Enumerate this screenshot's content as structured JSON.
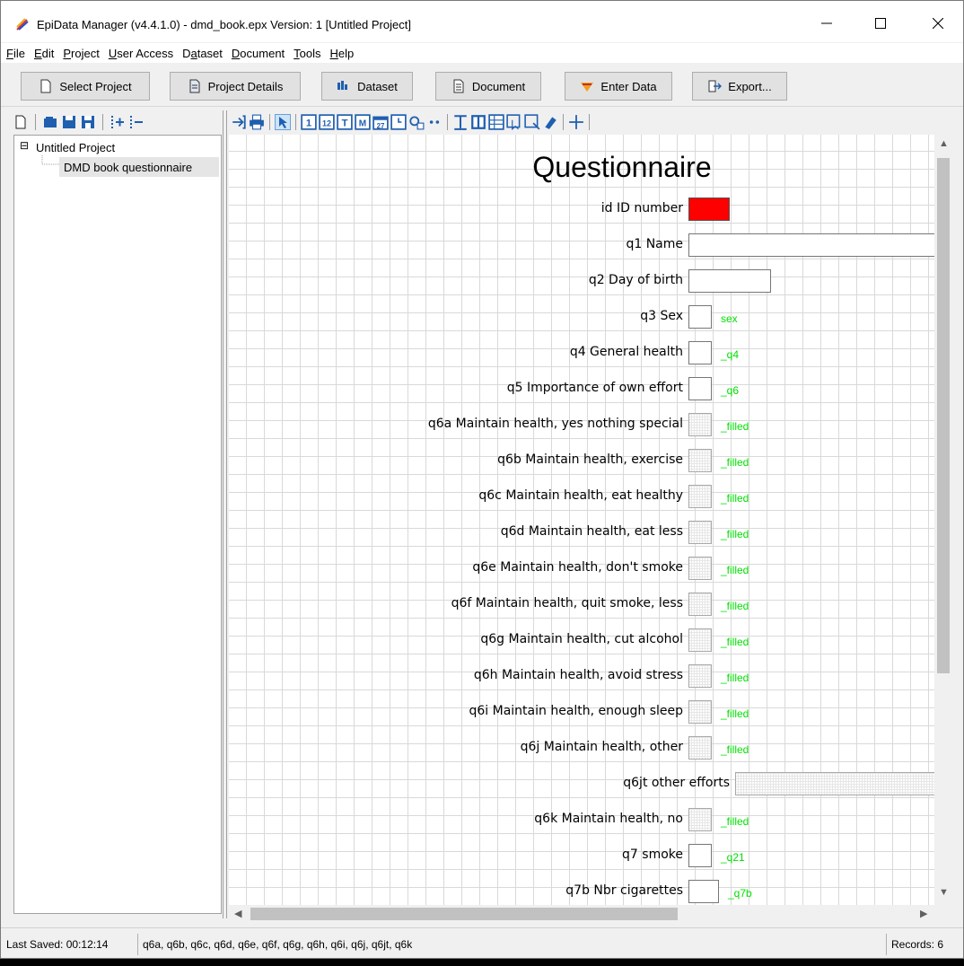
{
  "window": {
    "title": "EpiData Manager (v4.4.1.0) - dmd_book.epx Version: 1 [Untitled Project]",
    "minimize_glyph": "—",
    "maximize_glyph": "☐",
    "close_glyph": "✕"
  },
  "menu": [
    {
      "key": "F",
      "rest": "ile"
    },
    {
      "key": "E",
      "rest": "dit"
    },
    {
      "key": "P",
      "rest": "roject",
      "pre": ""
    },
    {
      "key": "U",
      "rest": "ser Access"
    },
    {
      "key": "a",
      "pre": "D",
      "rest": "taset"
    },
    {
      "key": "D",
      "rest": "ocument"
    },
    {
      "key": "T",
      "rest": "ools"
    },
    {
      "key": "H",
      "rest": "elp"
    }
  ],
  "toolbar": {
    "select_project": "Select Project",
    "project_details": "Project Details",
    "dataset": "Dataset",
    "document": "Document",
    "enter_data": "Enter Data",
    "export": "Export..."
  },
  "tree": {
    "root": "Untitled Project",
    "child": "DMD book questionnaire",
    "expander": "⊟"
  },
  "form": {
    "heading": "Questionnaire",
    "fields": [
      {
        "label": "id ID number",
        "box": "red",
        "width": 46,
        "vlabel": ""
      },
      {
        "label": "q1 Name",
        "box": "plain",
        "width": 290,
        "vlabel": ""
      },
      {
        "label": "q2 Day of birth",
        "box": "plain",
        "width": 92,
        "vlabel": ""
      },
      {
        "label": "q3 Sex",
        "box": "plain",
        "width": 26,
        "vlabel": "sex"
      },
      {
        "label": "q4 General health",
        "box": "plain",
        "width": 26,
        "vlabel": "_q4"
      },
      {
        "label": "q5 Importance of own effort",
        "box": "plain",
        "width": 26,
        "vlabel": "_q6"
      },
      {
        "label": "q6a Maintain health, yes nothing special",
        "box": "dotted",
        "width": 26,
        "vlabel": "_filled"
      },
      {
        "label": "q6b Maintain health, exercise",
        "box": "dotted",
        "width": 26,
        "vlabel": "_filled"
      },
      {
        "label": "q6c Maintain health, eat healthy",
        "box": "dotted",
        "width": 26,
        "vlabel": "_filled"
      },
      {
        "label": "q6d Maintain health, eat less",
        "box": "dotted",
        "width": 26,
        "vlabel": "_filled"
      },
      {
        "label": "q6e Maintain health, don't smoke",
        "box": "dotted",
        "width": 26,
        "vlabel": "_filled"
      },
      {
        "label": "q6f Maintain health, quit smoke, less",
        "box": "dotted",
        "width": 26,
        "vlabel": "_filled"
      },
      {
        "label": "q6g Maintain health, cut alcohol",
        "box": "dotted",
        "width": 26,
        "vlabel": "_filled"
      },
      {
        "label": "q6h Maintain health, avoid stress",
        "box": "dotted",
        "width": 26,
        "vlabel": "_filled"
      },
      {
        "label": "q6i Maintain health, enough sleep",
        "box": "dotted",
        "width": 26,
        "vlabel": "_filled"
      },
      {
        "label": "q6j Maintain health, other",
        "box": "dotted",
        "width": 26,
        "vlabel": "_filled"
      },
      {
        "label": "q6jt other efforts",
        "box": "dotted",
        "width": 240,
        "vlabel": "",
        "indent": 52
      },
      {
        "label": "q6k Maintain health, no",
        "box": "dotted",
        "width": 26,
        "vlabel": "_filled"
      },
      {
        "label": "q7 smoke",
        "box": "plain",
        "width": 26,
        "vlabel": "_q21"
      },
      {
        "label": "q7b Nbr cigarettes",
        "box": "plain",
        "width": 34,
        "vlabel": "_q7b"
      }
    ]
  },
  "status": {
    "last_saved": "Last Saved: 00:12:14",
    "fields": "q6a, q6b, q6c, q6d, q6e, q6f, q6g, q6h, q6i, q6j, q6jt, q6k",
    "records": "Records: 6"
  },
  "colors": {
    "id_field": "#ff0000",
    "value_label": "#00e000",
    "accent": "#1f5fb0"
  }
}
